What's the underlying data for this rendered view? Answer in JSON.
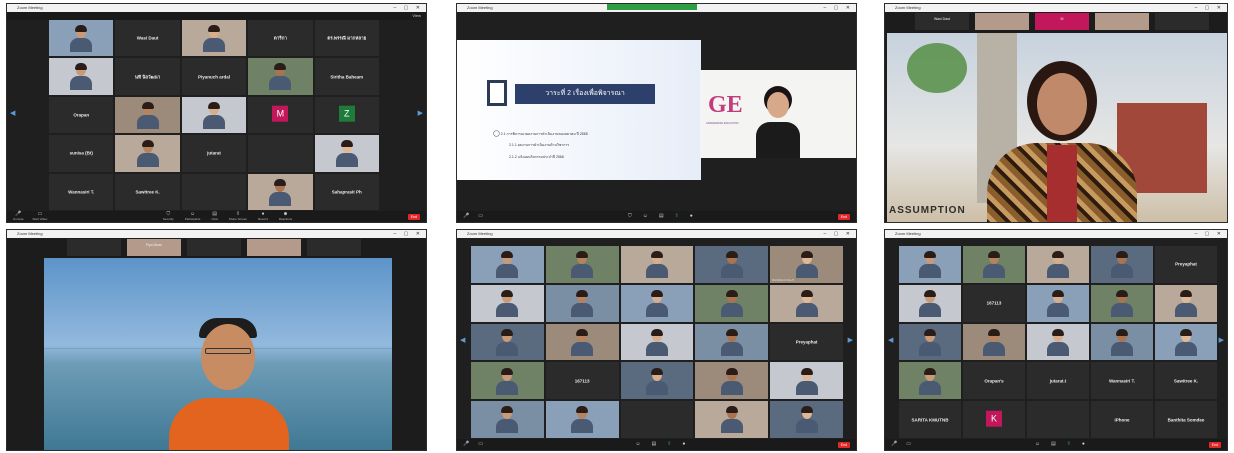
{
  "shot1": {
    "tiles": [
      {
        "name": "",
        "caption": "",
        "kind": "video"
      },
      {
        "name": "Wasi Daut",
        "caption": "",
        "kind": "name"
      },
      {
        "name": "",
        "caption": "",
        "kind": "video"
      },
      {
        "name": "ดาริกา",
        "caption": "",
        "kind": "name"
      },
      {
        "name": "ดร.พรรณี มากหลาย",
        "caption": "",
        "kind": "name"
      },
      {
        "name": "",
        "caption": "",
        "kind": "video"
      },
      {
        "name": "นที นิลวัฒนา",
        "caption": "",
        "kind": "name"
      },
      {
        "name": "Piyanuch ardal",
        "caption": "",
        "kind": "name"
      },
      {
        "name": "",
        "caption": "",
        "kind": "video"
      },
      {
        "name": "Siritha Baheam",
        "caption": "",
        "kind": "name"
      },
      {
        "name": "Orapan",
        "caption": "",
        "kind": "name"
      },
      {
        "name": "",
        "caption": "",
        "kind": "video"
      },
      {
        "name": "",
        "caption": "",
        "kind": "video"
      },
      {
        "name": "M",
        "caption": "",
        "kind": "avatar",
        "color": "#c2185b"
      },
      {
        "name": "Z",
        "caption": "",
        "kind": "avatar",
        "color": "#1e7b3a"
      },
      {
        "name": "sunisa (Bt)",
        "caption": "",
        "kind": "name"
      },
      {
        "name": "",
        "caption": "",
        "kind": "video"
      },
      {
        "name": "jutarat",
        "caption": "",
        "kind": "name"
      },
      {
        "name": "",
        "caption": "",
        "kind": "blank"
      },
      {
        "name": "",
        "caption": "",
        "kind": "video"
      },
      {
        "name": "Wannasiri T.",
        "caption": "",
        "kind": "name"
      },
      {
        "name": "Sawitree K.",
        "caption": "",
        "kind": "name"
      },
      {
        "name": "",
        "caption": "",
        "kind": "name"
      },
      {
        "name": "",
        "caption": "",
        "kind": "video"
      },
      {
        "name": "Sahaprasit Ph",
        "caption": "",
        "kind": "name"
      }
    ]
  },
  "shot2": {
    "slide_title": "วาระที่ 2 เรื่องเพื่อพิจารณา",
    "slide_lines": [
      "2.1 การพิจารณาผลงานการดำเนินงานของสมาคม ปี 2565",
      "2.1.1 ผลงานการดำเนินงานด้านวิชาการ",
      "2.1.2 แจ้งแผนกิจกรรมประจำปี 2566"
    ],
    "speaker_caption": "",
    "logo_text": "GE",
    "logo_sub": "GRAMMARIAN EDUCATION"
  },
  "shot3": {
    "strip": [
      "Wasi Daut",
      "",
      "M",
      "",
      ""
    ],
    "banner_text": "ASSUMPTION"
  },
  "shot4": {
    "strip": [
      "",
      "Piya Muan",
      "",
      "",
      ""
    ]
  },
  "shot5": {
    "tiles": [
      {
        "name": "",
        "kind": "video"
      },
      {
        "name": "",
        "kind": "video"
      },
      {
        "name": "",
        "kind": "video"
      },
      {
        "name": "",
        "kind": "video"
      },
      {
        "name": "BANKEN FIGHT",
        "kind": "video"
      },
      {
        "name": "",
        "kind": "video"
      },
      {
        "name": "",
        "kind": "video"
      },
      {
        "name": "",
        "kind": "video"
      },
      {
        "name": "",
        "kind": "video"
      },
      {
        "name": "",
        "kind": "video"
      },
      {
        "name": "",
        "kind": "video"
      },
      {
        "name": "",
        "kind": "video"
      },
      {
        "name": "",
        "kind": "video"
      },
      {
        "name": "",
        "kind": "video"
      },
      {
        "name": "Preyaphat",
        "kind": "name"
      },
      {
        "name": "",
        "kind": "video"
      },
      {
        "name": "167113",
        "kind": "name"
      },
      {
        "name": "",
        "kind": "video"
      },
      {
        "name": "",
        "kind": "video"
      },
      {
        "name": "",
        "kind": "video"
      },
      {
        "name": "",
        "kind": "video"
      },
      {
        "name": "",
        "kind": "video"
      },
      {
        "name": "",
        "kind": "name"
      },
      {
        "name": "",
        "kind": "video"
      },
      {
        "name": "",
        "kind": "video"
      }
    ]
  },
  "shot6": {
    "tiles": [
      {
        "name": "",
        "kind": "video"
      },
      {
        "name": "",
        "kind": "video"
      },
      {
        "name": "",
        "kind": "video"
      },
      {
        "name": "",
        "kind": "video"
      },
      {
        "name": "Preyaphat",
        "kind": "name"
      },
      {
        "name": "",
        "kind": "video"
      },
      {
        "name": "167113",
        "kind": "name"
      },
      {
        "name": "",
        "kind": "video"
      },
      {
        "name": "",
        "kind": "video"
      },
      {
        "name": "",
        "kind": "video"
      },
      {
        "name": "",
        "kind": "video"
      },
      {
        "name": "",
        "kind": "video"
      },
      {
        "name": "",
        "kind": "video"
      },
      {
        "name": "",
        "kind": "video"
      },
      {
        "name": "",
        "kind": "video"
      },
      {
        "name": "",
        "kind": "video"
      },
      {
        "name": "Orapan's",
        "kind": "name"
      },
      {
        "name": "jutarat.t",
        "kind": "name"
      },
      {
        "name": "Wannasiri T.",
        "kind": "name"
      },
      {
        "name": "Sawitree K.",
        "kind": "name"
      },
      {
        "name": "SARITA KMUTNB",
        "kind": "name"
      },
      {
        "name": "K",
        "kind": "avatar",
        "color": "#c2185b"
      },
      {
        "name": "",
        "kind": "name"
      },
      {
        "name": "iPhone",
        "kind": "name"
      },
      {
        "name": "Banthita Somdee",
        "kind": "name"
      }
    ]
  },
  "toolbar": {
    "mute": "Unmute",
    "video": "Start Video",
    "security": "Security",
    "participants": "Participants",
    "chat": "Chat",
    "share": "Share Screen",
    "record": "Record",
    "reactions": "Reactions",
    "end": "End"
  },
  "window": {
    "app": "Zoom Meeting",
    "view": "View"
  }
}
